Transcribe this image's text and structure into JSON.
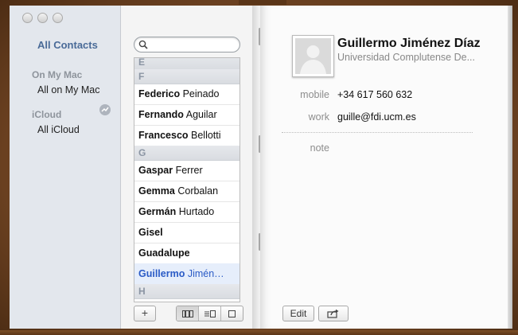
{
  "sidebar": {
    "all_contacts": "All Contacts",
    "groups": [
      {
        "header": "On My Mac",
        "item": "All on My Mac"
      },
      {
        "header": "iCloud",
        "item": "All iCloud"
      }
    ]
  },
  "list": {
    "rows": [
      {
        "type": "section",
        "text": "E"
      },
      {
        "type": "section",
        "text": "F"
      },
      {
        "type": "contact",
        "first": "Federico",
        "last": "Peinado"
      },
      {
        "type": "contact",
        "first": "Fernando",
        "last": "Aguilar"
      },
      {
        "type": "contact",
        "first": "Francesco",
        "last": "Bellotti"
      },
      {
        "type": "section",
        "text": "G"
      },
      {
        "type": "contact",
        "first": "Gaspar",
        "last": "Ferrer"
      },
      {
        "type": "contact",
        "first": "Gemma",
        "last": "Corbalan"
      },
      {
        "type": "contact",
        "first": "Germán",
        "last": "Hurtado"
      },
      {
        "type": "contact",
        "first": "Gisel",
        "last": ""
      },
      {
        "type": "contact",
        "first": "Guadalupe",
        "last": ""
      },
      {
        "type": "contact",
        "first": "Guillermo",
        "last": "Jimén…",
        "selected": true
      },
      {
        "type": "section",
        "text": "H"
      }
    ]
  },
  "toolbar": {
    "add_label": "+"
  },
  "card": {
    "name": "Guillermo Jiménez Díaz",
    "company": "Universidad Complutense De...",
    "fields": [
      {
        "label": "mobile",
        "value": "+34 617 560 632"
      },
      {
        "label": "work",
        "value": "guille@fdi.ucm.es"
      },
      {
        "label": "note",
        "value": ""
      }
    ]
  },
  "footer": {
    "edit_label": "Edit"
  },
  "icons": {
    "search": "magnifier-icon",
    "sync": "sync-icon",
    "share": "share-icon",
    "photo": "person-silhouette-icon"
  },
  "colors": {
    "accent": "#4a6b98",
    "selected_text": "#2a5bc6",
    "leather": "#6e4523"
  }
}
